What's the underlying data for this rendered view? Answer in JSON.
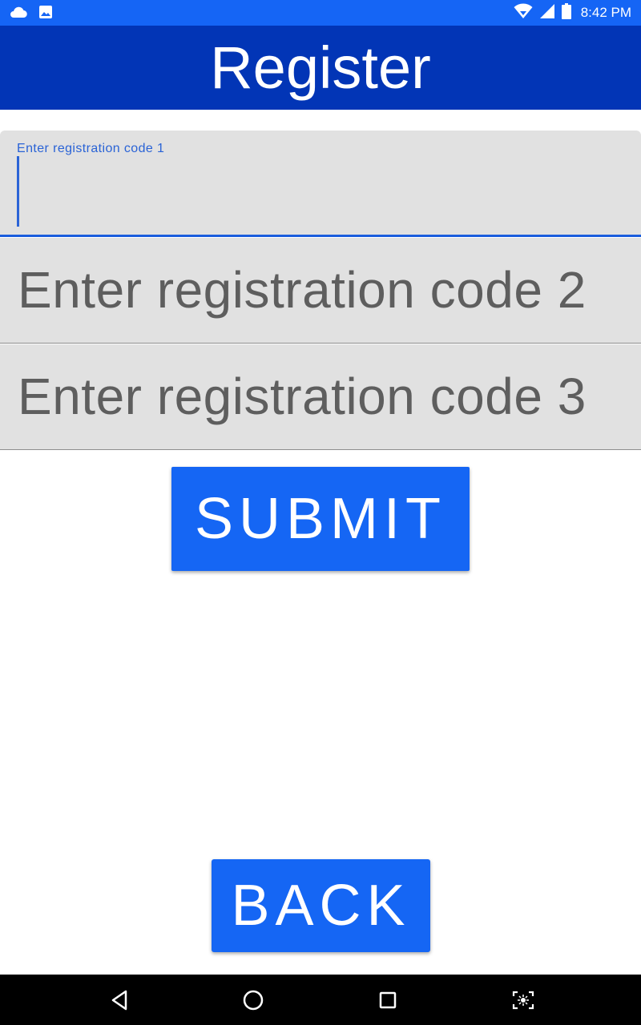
{
  "status_bar": {
    "time": "8:42 PM",
    "left_icons": [
      "cloud-icon",
      "image-icon"
    ],
    "right_icons": [
      "wifi-icon",
      "signal-icon",
      "battery-icon"
    ],
    "color": "#1565f5"
  },
  "app_bar": {
    "title": "Register",
    "color": "#0235b6"
  },
  "form": {
    "code1": {
      "label": "Enter registration code 1",
      "value": "",
      "focused": true
    },
    "code2": {
      "placeholder": "Enter registration code 2",
      "value": ""
    },
    "code3": {
      "placeholder": "Enter registration code 3",
      "value": ""
    }
  },
  "buttons": {
    "submit_label": "SUBMIT",
    "back_label": "BACK",
    "color": "#1566f4"
  },
  "nav_bar": {
    "items": [
      "back-icon",
      "home-icon",
      "recents-icon",
      "screenshot-icon"
    ]
  }
}
